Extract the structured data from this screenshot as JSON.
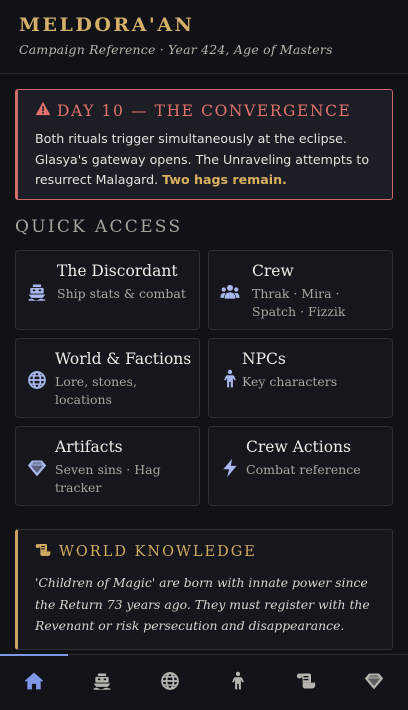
{
  "header": {
    "title": "MELDORA'AN",
    "subtitle": "Campaign Reference · Year 424, Age of Masters"
  },
  "alert": {
    "icon": "warning-icon",
    "title": "DAY 10 — THE CONVERGENCE",
    "body": "Both rituals trigger simultaneously at the eclipse. Glasya's gateway opens. The Unraveling attempts to resurrect Malagard.",
    "highlight": "Two hags remain.",
    "color": "#d0706b"
  },
  "quick_access": {
    "title": "QUICK ACCESS",
    "cards": [
      {
        "title": "The Discordant",
        "desc": "Ship stats & combat",
        "icon": "ship-icon"
      },
      {
        "title": "Crew",
        "desc": "Thrak · Mira · Spatch · Fizzik",
        "icon": "users-icon"
      },
      {
        "title": "World & Factions",
        "desc": "Lore, stones, locations",
        "icon": "globe-icon"
      },
      {
        "title": "NPCs",
        "desc": "Key characters",
        "icon": "person-icon"
      },
      {
        "title": "Artifacts",
        "desc": "Seven sins · Hag tracker",
        "icon": "gem-icon"
      },
      {
        "title": "Crew Actions",
        "desc": "Combat reference",
        "icon": "bolt-icon"
      }
    ]
  },
  "world_knowledge": {
    "title": "WORLD KNOWLEDGE",
    "icon": "scroll-icon",
    "body": "'Children of Magic' are born with innate power since the Return 73 years ago. They must register with the Revenant or risk persecution and disappearance."
  },
  "nav": {
    "items": [
      {
        "icon": "home-icon",
        "active": true
      },
      {
        "icon": "ship-icon",
        "active": false
      },
      {
        "icon": "globe-icon",
        "active": false
      },
      {
        "icon": "person-icon",
        "active": false
      },
      {
        "icon": "scroll-icon",
        "active": false
      },
      {
        "icon": "gem-icon",
        "active": false
      }
    ]
  },
  "colors": {
    "accent_gold": "#d4b06a",
    "accent_blue": "#7f97e6",
    "alert_red": "#d0706b",
    "background": "#111216"
  }
}
